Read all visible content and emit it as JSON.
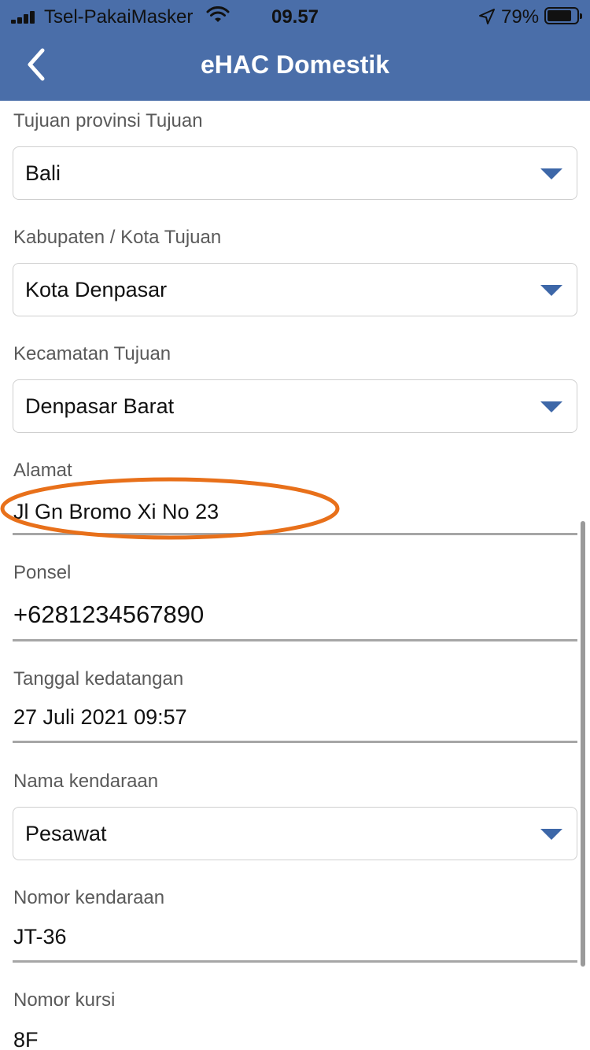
{
  "status_bar": {
    "carrier": "Tsel-PakaiMasker",
    "time": "09.57",
    "battery_percent": "79%",
    "icons": [
      "signal-icon",
      "wifi-icon",
      "location-arrow-icon",
      "battery-icon"
    ]
  },
  "header": {
    "title": "eHAC Domestik",
    "back_icon": "chevron-left-icon",
    "background": "#4a6ea9"
  },
  "form": {
    "province": {
      "label": "Tujuan provinsi Tujuan",
      "value": "Bali"
    },
    "city": {
      "label": "Kabupaten / Kota Tujuan",
      "value": "Kota Denpasar"
    },
    "district": {
      "label": "Kecamatan Tujuan",
      "value": "Denpasar Barat"
    },
    "address": {
      "label": "Alamat",
      "value": "Jl Gn Bromo Xi No 23"
    },
    "phone": {
      "label": "Ponsel",
      "value": "+6281234567890"
    },
    "arrival": {
      "label": "Tanggal kedatangan",
      "value": "27 Juli 2021 09:57"
    },
    "vehicle_name": {
      "label": "Nama kendaraan",
      "value": "Pesawat"
    },
    "vehicle_number": {
      "label": "Nomor kendaraan",
      "value": "JT-36"
    },
    "seat": {
      "label": "Nomor kursi",
      "value": "8F"
    }
  },
  "colors": {
    "accent": "#3d67a8",
    "highlight": "#e8701a"
  }
}
